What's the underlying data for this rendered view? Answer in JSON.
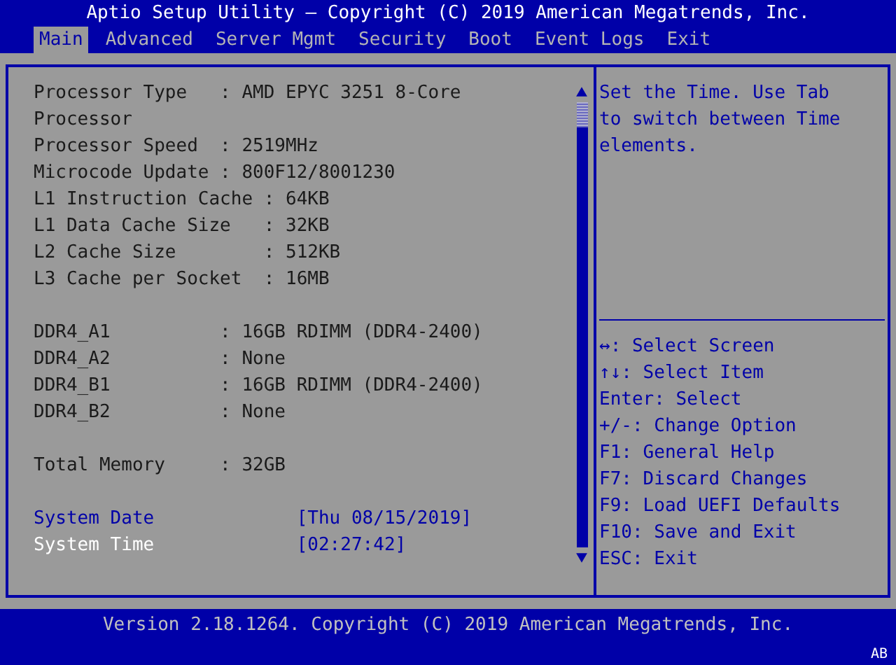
{
  "title": "Aptio Setup Utility – Copyright (C) 2019 American Megatrends, Inc.",
  "tabs": [
    {
      "label": "Main",
      "selected": true
    },
    {
      "label": "Advanced",
      "selected": false
    },
    {
      "label": "Server Mgmt",
      "selected": false
    },
    {
      "label": "Security",
      "selected": false
    },
    {
      "label": "Boot",
      "selected": false
    },
    {
      "label": "Event Logs",
      "selected": false
    },
    {
      "label": "Exit",
      "selected": false
    }
  ],
  "separator": ":",
  "info_groups": [
    {
      "blocks": [
        {
          "rows": [
            {
              "label": "Processor Type",
              "value": "AMD EPYC 3251 8-Core",
              "wrap": "Processor"
            },
            {
              "label": "Processor Speed",
              "value": "2519MHz"
            },
            {
              "label": "Microcode Update",
              "value": "800F12/8001230"
            }
          ]
        },
        {
          "rows": [
            {
              "label": "L1 Instruction Cache",
              "value": "64KB"
            },
            {
              "label": "L1 Data Cache Size",
              "value": "32KB"
            },
            {
              "label": "L2 Cache Size",
              "value": "512KB"
            },
            {
              "label": "L3 Cache per Socket",
              "value": "16MB"
            }
          ]
        }
      ]
    },
    {
      "blocks": [
        {
          "rows": [
            {
              "label": "DDR4_A1",
              "value": "16GB RDIMM (DDR4-2400)"
            },
            {
              "label": "DDR4_A2",
              "value": "None"
            },
            {
              "label": "DDR4_B1",
              "value": "16GB RDIMM (DDR4-2400)"
            },
            {
              "label": "DDR4_B2",
              "value": "None"
            }
          ]
        }
      ]
    },
    {
      "blocks": [
        {
          "rows": [
            {
              "label": "Total Memory",
              "value": "32GB"
            }
          ]
        }
      ]
    }
  ],
  "settings": [
    {
      "label": "System Date",
      "value": "[Thu 08/15/2019]",
      "selected": false
    },
    {
      "label": "System Time",
      "value": "[02:27:42]",
      "selected": true
    }
  ],
  "help_text": "Set the Time. Use Tab to switch between Time elements.",
  "keys": [
    "↔: Select Screen",
    "↑↓: Select Item",
    "Enter: Select",
    "+/-: Change Option",
    "F1: General Help",
    "F7: Discard Changes",
    "F9: Load UEFI Defaults",
    "F10: Save and Exit",
    "ESC: Exit"
  ],
  "footer": "Version 2.18.1264. Copyright (C) 2019 American Megatrends, Inc.",
  "corner_mark": "AB"
}
